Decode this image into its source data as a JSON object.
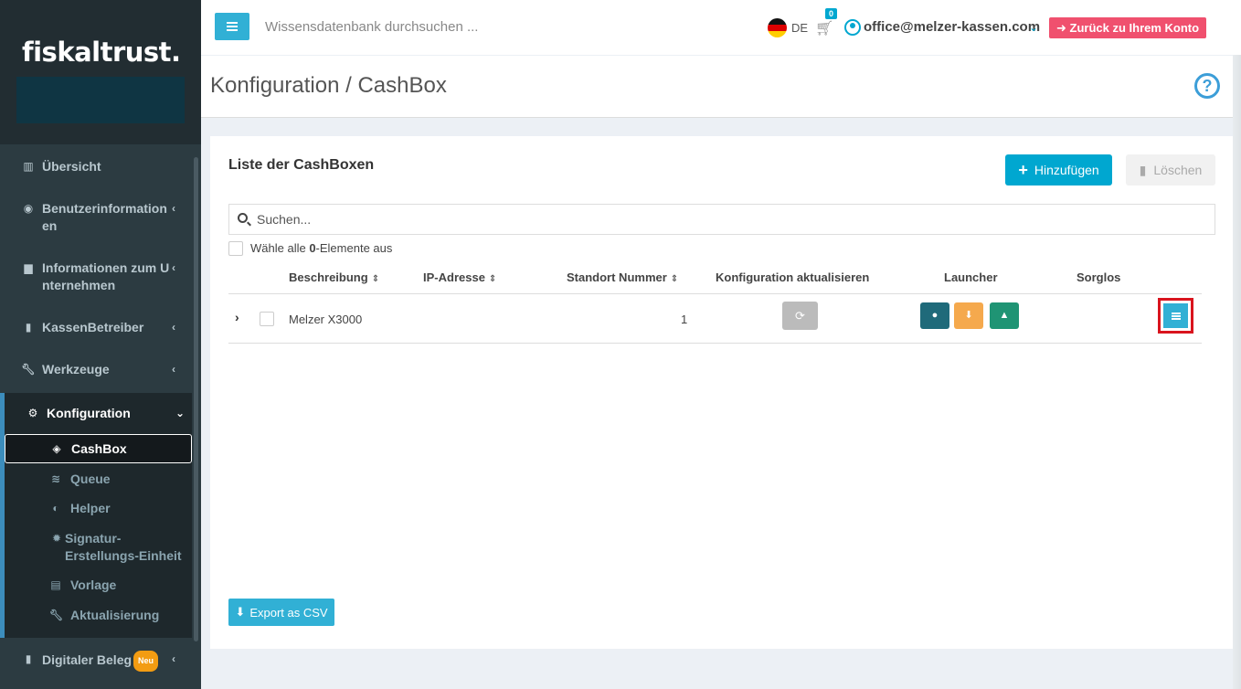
{
  "sidebar": {
    "logo": "fiskaltrust.",
    "items": [
      {
        "label": "Übersicht",
        "icon": "bar-chart-icon"
      },
      {
        "label": "Benutzerinformation\nen",
        "icon": "user-circle-icon"
      },
      {
        "label": "Informationen zum U\nnternehmen",
        "icon": "briefcase-icon"
      },
      {
        "label": "KassenBetreiber",
        "icon": "building-icon"
      },
      {
        "label": "Werkzeuge",
        "icon": "wrench-icon"
      },
      {
        "label": "Konfiguration",
        "icon": "cogs-icon"
      },
      {
        "label": "Digitaler Beleg",
        "icon": "file-icon",
        "badge": "Neu"
      }
    ],
    "sub_items": [
      {
        "label": "CashBox",
        "icon": "cube-icon"
      },
      {
        "label": "Queue",
        "icon": "database-icon"
      },
      {
        "label": "Helper",
        "icon": "adjust-icon"
      },
      {
        "label": "Signatur-\nErstellungs-Einheit",
        "icon": "certificate-icon"
      },
      {
        "label": "Vorlage",
        "icon": "file-text-icon"
      },
      {
        "label": "Aktualisierung",
        "icon": "wrench-icon"
      }
    ]
  },
  "topbar": {
    "search_placeholder": "Wissensdatenbank durchsuchen ...",
    "language": "DE",
    "cart_count": "0",
    "user_email": "office@melzer-kassen.com",
    "back_button": "Zurück zu Ihrem Konto"
  },
  "page": {
    "title": "Konfiguration / CashBox",
    "help": "?"
  },
  "box": {
    "title": "Liste der CashBoxen",
    "add_button": "Hinzufügen",
    "delete_button": "Löschen",
    "search_placeholder": "Suchen...",
    "select_all_prefix": "Wähle alle ",
    "select_all_count": "0",
    "select_all_suffix": "-Elemente aus",
    "columns": {
      "beschreibung": "Beschreibung",
      "ip": "IP-Adresse",
      "standort": "Standort Nummer",
      "konfig": "Konfiguration aktualisieren",
      "launcher": "Launcher",
      "sorglos": "Sorglos"
    },
    "rows": [
      {
        "beschreibung": "Melzer X3000",
        "ip": "",
        "standort": "1"
      }
    ],
    "launcher_colors": {
      "windows": "#1f6a7a",
      "download": "#f5a94d",
      "linux": "#1f9474"
    },
    "export_button": "Export as CSV"
  },
  "colors": {
    "sidebar_bg": "#2c3b41",
    "accent": "#00a7d0",
    "back_button": "#f0506e",
    "highlight": "#d9141e"
  }
}
